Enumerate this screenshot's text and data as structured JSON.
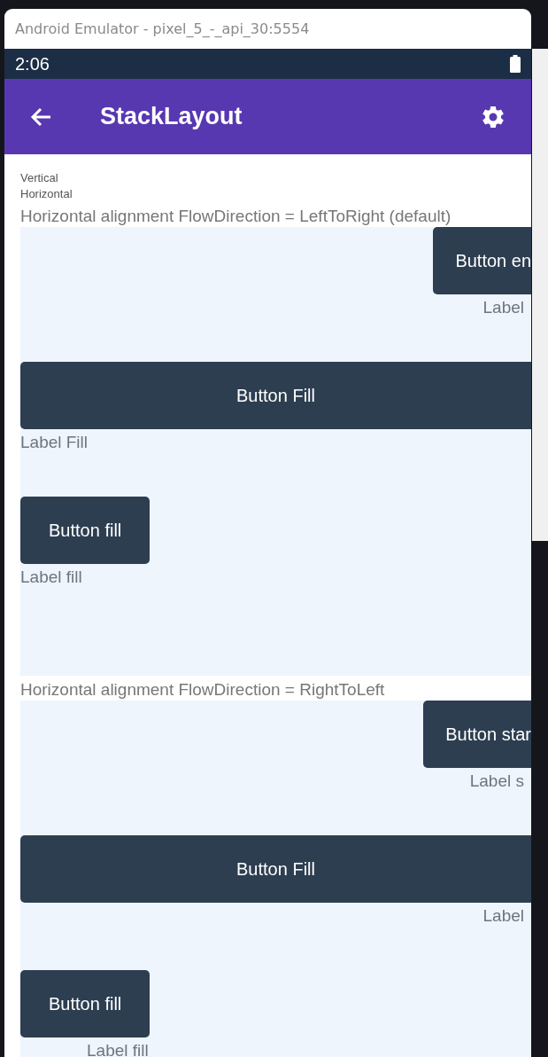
{
  "window": {
    "title": "Android Emulator - pixel_5_-_api_30:5554"
  },
  "status_bar": {
    "time": "2:06"
  },
  "toolbar": {
    "title": "StackLayout"
  },
  "options": [
    "Vertical",
    "Horizontal"
  ],
  "sections": [
    {
      "heading": "Horizontal alignment FlowDirection = LeftToRight (default)",
      "rows": [
        {
          "button": {
            "label": "Button en",
            "kind": "end"
          },
          "label": {
            "text": "Label",
            "kind": "end"
          }
        },
        {
          "button": {
            "label": "Button Fill",
            "kind": "fill"
          },
          "label": {
            "text": "Label Fill",
            "kind": "start"
          }
        },
        {
          "button": {
            "label": "Button fill",
            "kind": "start"
          },
          "label": {
            "text": "Label fill",
            "kind": "start"
          }
        }
      ]
    },
    {
      "heading": "Horizontal alignment FlowDirection = RightToLeft",
      "rows": [
        {
          "button": {
            "label": "Button star",
            "kind": "end"
          },
          "label": {
            "text": "Label s",
            "kind": "end"
          }
        },
        {
          "button": {
            "label": "Button Fill",
            "kind": "fill"
          },
          "label": {
            "text": "Label",
            "kind": "end"
          }
        },
        {
          "button": {
            "label": "Button fill",
            "kind": "start"
          },
          "label": {
            "text": "Label fill",
            "kind": "indent"
          }
        }
      ]
    }
  ]
}
